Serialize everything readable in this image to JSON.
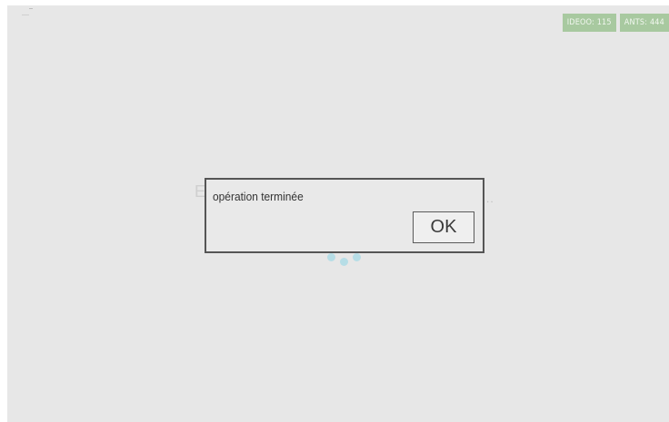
{
  "status": {
    "badges": [
      {
        "label": "IDEOO: 115"
      },
      {
        "label": "ANTS: 444"
      }
    ]
  },
  "background": {
    "left_fragment": "E",
    "right_fragment": ".."
  },
  "dialog": {
    "message": "opération terminée",
    "ok_label": "OK"
  },
  "colors": {
    "badge_bg": "#a8c9a0",
    "loader_dot": "#b6dde6",
    "dialog_border": "#555555",
    "screen_bg": "#e7e7e7"
  }
}
